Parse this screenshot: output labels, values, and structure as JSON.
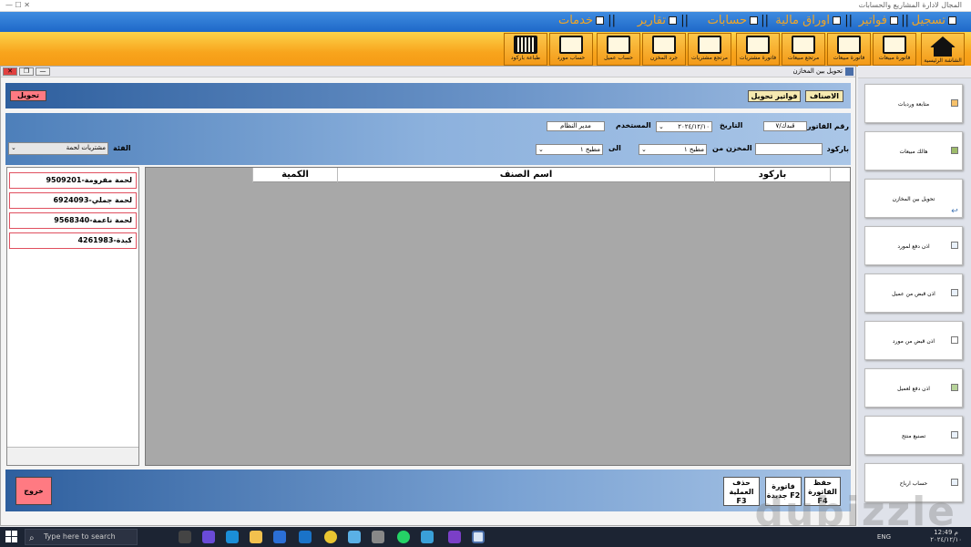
{
  "app": {
    "title": "المجال لادارة المشاريع والحسابات"
  },
  "menu": [
    {
      "label": "تسجيل"
    },
    {
      "label": "فواتير"
    },
    {
      "label": "اوراق مالية"
    },
    {
      "label": "حسابات"
    },
    {
      "label": "تقارير"
    },
    {
      "label": "خدمات"
    }
  ],
  "toolbar": [
    {
      "label": "الشاشة الرئيسية",
      "icon": "home-icon"
    },
    {
      "label": "فاتورة مبيعات",
      "icon": "sales-invoice-icon"
    },
    {
      "label": "فاتورة مبيعات",
      "icon": "calculator-icon"
    },
    {
      "label": "مرتجع مبيعات",
      "icon": "returns-icon"
    },
    {
      "label": "فاتورة مشتريات",
      "icon": "purchase-invoice-icon"
    },
    {
      "label": "مرتجع مشتريات",
      "icon": "purchase-return-icon"
    },
    {
      "label": "مصروفات",
      "icon": "expenses-icon"
    },
    {
      "label": "جرد المخزن",
      "icon": "inventory-icon"
    },
    {
      "label": "حساب عميل",
      "icon": "customer-account-icon"
    },
    {
      "label": "حساب مورد",
      "icon": "supplier-account-icon"
    },
    {
      "label": "طباعة باركود",
      "icon": "barcode-icon"
    }
  ],
  "window": {
    "title": "تحويل بين المخازن"
  },
  "topband": {
    "transfer_label": "تحويل",
    "items_label": "الاصناف",
    "invoices_label": "فواتير تحويل"
  },
  "form": {
    "invoice_no_label": "رقم الفاتورة",
    "invoice_no": "قبدك/٧",
    "date_label": "التاريخ",
    "date": "٢٠٢٤/١٢/١٠",
    "user_label": "المستخدم",
    "user": "مدير النظام",
    "barcode_label": "باركود",
    "barcode": "",
    "from_store_label": "المخزن من",
    "from_store": "مطبخ ١",
    "to_label": "الى",
    "to_store": "مطبخ ١",
    "category_label": "الفئة",
    "category": "مشتريات لحمة"
  },
  "categories": [
    {
      "label": "لحمة مفرومة-9509201"
    },
    {
      "label": "لحمة جملي-6924093"
    },
    {
      "label": "لحمة ناعمة-9568340"
    },
    {
      "label": "كبدة-4261983"
    }
  ],
  "grid": {
    "col_barcode": "باركود",
    "col_name": "اسم الصنف",
    "col_qty": "الكمية"
  },
  "bottom": {
    "exit": "خروج",
    "save": "حفظ\nالفاتورة\nF4",
    "new": "فاتورة\nجديدة F2",
    "delete": "حذف\nالعملية\nF3"
  },
  "sidebar": [
    {
      "label": "متابعة وردبات"
    },
    {
      "label": "هالك مبيعات"
    },
    {
      "label": "تحويل بين المخازن"
    },
    {
      "label": "اذن دفع لمورد"
    },
    {
      "label": "اذن قبض من عميل"
    },
    {
      "label": "اذن قبض من مورد"
    },
    {
      "label": "اذن دفع لعميل"
    },
    {
      "label": "تصنيع منتج"
    },
    {
      "label": "حساب ارباح"
    }
  ],
  "taskbar": {
    "search_placeholder": "Type here to search",
    "time": "12:49 م",
    "date": "٢٠٢٤/١٢/١٠",
    "lang": "ENG"
  }
}
